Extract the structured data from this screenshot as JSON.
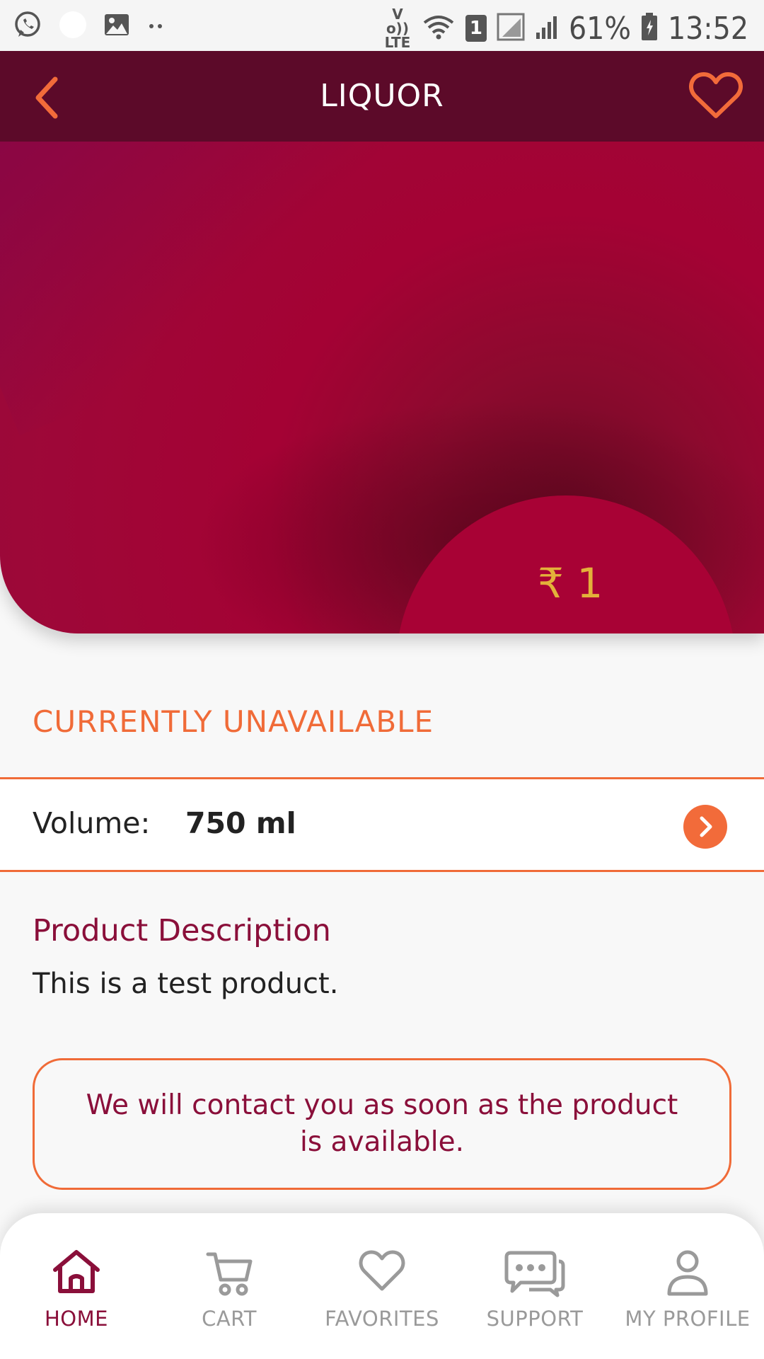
{
  "status_bar": {
    "battery": "61%",
    "time": "13:52",
    "sim_badge": "1",
    "volte": "Vo)) LTE"
  },
  "header": {
    "title": "LIQUOR"
  },
  "hero": {
    "price": "₹ 1"
  },
  "availability": "CURRENTLY UNAVAILABLE",
  "volume": {
    "label": "Volume:",
    "value": "750 ml"
  },
  "description": {
    "title": "Product Description",
    "text": "This is a test product."
  },
  "notice": "We will contact you as soon as the product is available.",
  "bottom_nav": {
    "items": [
      {
        "label": "HOME",
        "icon": "home-icon",
        "active": true
      },
      {
        "label": "CART",
        "icon": "cart-icon",
        "active": false
      },
      {
        "label": "FAVORITES",
        "icon": "heart-icon",
        "active": false
      },
      {
        "label": "SUPPORT",
        "icon": "chat-icon",
        "active": false
      },
      {
        "label": "MY PROFILE",
        "icon": "user-icon",
        "active": false
      }
    ]
  },
  "colors": {
    "header_bg": "#5c0a29",
    "accent_orange": "#f06b38",
    "brand_maroon": "#8a0f3a",
    "price_gold": "#e3b13a",
    "inactive_gray": "#9a9a9a"
  }
}
